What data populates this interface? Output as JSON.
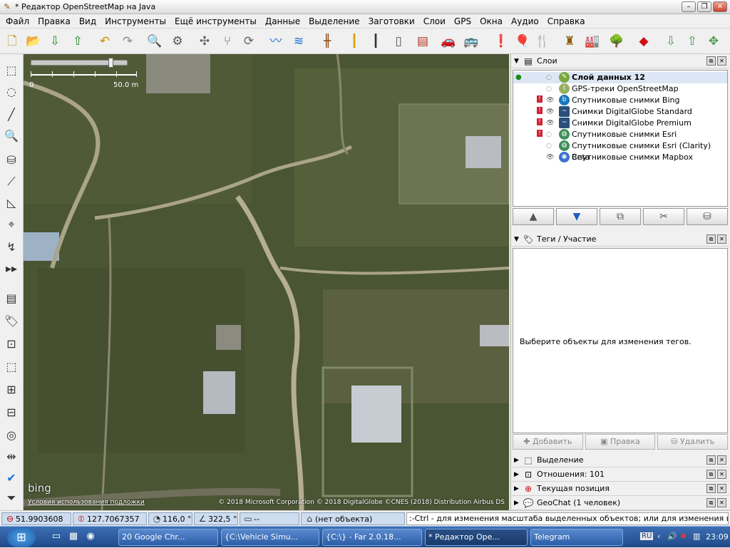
{
  "window": {
    "title": "* Редактор OpenStreetMap на Java"
  },
  "menu": [
    "Файл",
    "Правка",
    "Вид",
    "Инструменты",
    "Ещё инструменты",
    "Данные",
    "Выделение",
    "Заготовки",
    "Слои",
    "GPS",
    "Окна",
    "Аудио",
    "Справка"
  ],
  "map": {
    "scale_zero": "0",
    "scale_label": "50.0 m",
    "attribution": "© 2018 Microsoft Corporation © 2018 DigitalGlobe ©CNES (2018) Distribution Airbus DS",
    "terms_link": "Условия использования подложки",
    "logo": "bing"
  },
  "panels": {
    "layers_title": "Слои",
    "layers": [
      {
        "name": "Слой данных 12",
        "icon": "data-layer-icon",
        "active": true,
        "visible": true,
        "warning": false
      },
      {
        "name": "GPS-треки OpenStreetMap",
        "icon": "gps-icon",
        "active": false,
        "visible": false,
        "warning": false
      },
      {
        "name": "Спутниковые снимки Bing",
        "icon": "bing-icon",
        "active": false,
        "visible": true,
        "warning": true
      },
      {
        "name": "Снимки DigitalGlobe Standard",
        "icon": "digitalglobe-icon",
        "active": false,
        "visible": true,
        "warning": true
      },
      {
        "name": "Снимки DigitalGlobe Premium",
        "icon": "digitalglobe-icon",
        "active": false,
        "visible": true,
        "warning": true
      },
      {
        "name": "Спутниковые снимки Esri",
        "icon": "esri-icon",
        "active": false,
        "visible": false,
        "warning": true
      },
      {
        "name": "Спутниковые снимки Esri (Clarity) Beta",
        "icon": "esri-icon",
        "active": false,
        "visible": false,
        "warning": false
      },
      {
        "name": "Спутниковые снимки Mapbox",
        "icon": "mapbox-icon",
        "active": false,
        "visible": true,
        "warning": false
      }
    ],
    "tags_title": "Теги / Участие",
    "tags_message": "Выберите объекты для изменения тегов.",
    "tag_buttons": {
      "add": "Добавить",
      "edit": "Правка",
      "delete": "Удалить"
    },
    "selection_title": "Выделение",
    "relations_title": "Отношения: 101",
    "position_title": "Текущая позиция",
    "geochat_title": "GeoChat (1 человек)"
  },
  "status": {
    "lat": "51.9903608",
    "lon": "127.7067357",
    "heading": "116,0 °",
    "angle": "322,5 °",
    "distance": "--",
    "object": "(нет объекта)",
    "hint": ":-Ctrl - для изменения масштаба выделенных объектов; или для изменения выделения"
  },
  "taskbar": {
    "tasks": [
      {
        "label": "20  Google Chr...",
        "active": false
      },
      {
        "label": "{C:\\Vehicle Simu...",
        "active": false
      },
      {
        "label": "{C:\\} - Far 2.0.18...",
        "active": false
      },
      {
        "label": "* Редактор Ope...",
        "active": true
      },
      {
        "label": "Telegram",
        "active": false
      }
    ],
    "lang": "RU",
    "clock": "23:09"
  },
  "colors": {
    "accent": "#1f4a8a",
    "status_field": "#cdddef",
    "map_bg": "#4b5634"
  }
}
